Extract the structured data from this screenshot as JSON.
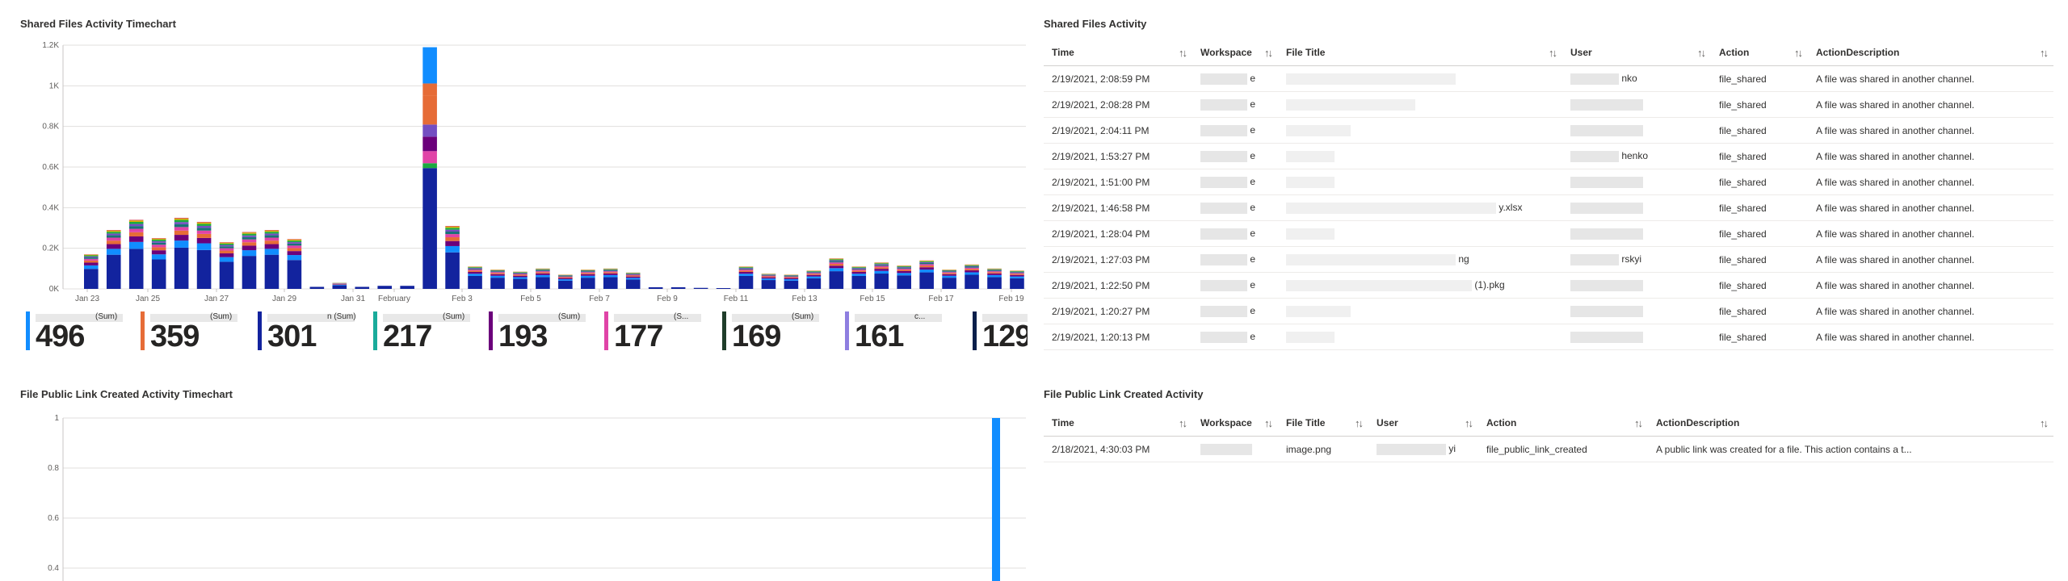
{
  "panels": {
    "shared_chart_title": "Shared Files Activity Timechart",
    "shared_table_title": "Shared Files Activity",
    "public_chart_title": "File Public Link Created Activity Timechart",
    "public_table_title": "File Public Link Created Activity"
  },
  "chart_data": [
    {
      "type": "bar",
      "stacked": true,
      "title": "Shared Files Activity Timechart",
      "y_ticks": [
        "0K",
        "0.2K",
        "0.4K",
        "0.6K",
        "0.8K",
        "1K",
        "1.2K"
      ],
      "ylim": [
        0,
        1200
      ],
      "x_ticks": [
        "Jan 23",
        "Jan 25",
        "Jan 27",
        "Jan 29",
        "Jan 31",
        "February",
        "Feb 3",
        "Feb 5",
        "Feb 7",
        "Feb 9",
        "Feb 11",
        "Feb 13",
        "Feb 15",
        "Feb 17",
        "Feb 19"
      ],
      "grid": true,
      "colors": [
        "#12239e",
        "#118dff",
        "#e66c37",
        "#6b007b",
        "#e044a7",
        "#744ec2",
        "#1aab40",
        "#d9b300",
        "#d64550",
        "#197278"
      ],
      "totals": [
        170,
        290,
        340,
        250,
        350,
        330,
        230,
        280,
        290,
        245,
        10,
        30,
        10,
        15,
        15,
        1190,
        310,
        110,
        95,
        85,
        100,
        70,
        95,
        100,
        80,
        8,
        8,
        5,
        4,
        110,
        75,
        70,
        90,
        150,
        110,
        130,
        115,
        140,
        95,
        120,
        100,
        90
      ]
    },
    {
      "type": "bar",
      "title": "File Public Link Created Activity Timechart",
      "y_ticks": [
        "0.4",
        "0.6",
        "0.8",
        "1"
      ],
      "ylim": [
        0.3,
        1
      ],
      "values_note_series": "single spike on last day",
      "spike_value": 1,
      "grid": true,
      "color": "#118dff"
    }
  ],
  "tiles": [
    {
      "value": "496",
      "label": "(Sum)",
      "color": "#118dff"
    },
    {
      "value": "359",
      "label": "(Sum)",
      "color": "#e66c37"
    },
    {
      "value": "301",
      "label": "n (Sum)",
      "color": "#12239e"
    },
    {
      "value": "217",
      "label": "(Sum)",
      "color": "#1aab9b"
    },
    {
      "value": "193",
      "label": "(Sum)",
      "color": "#6b007b"
    },
    {
      "value": "177",
      "label": "(S...",
      "color": "#e044a7"
    },
    {
      "value": "169",
      "label": "(Sum)",
      "color": "#1f3d2a"
    },
    {
      "value": "161",
      "label": "c...",
      "color": "#8e7ee0"
    },
    {
      "value": "129",
      "label": "",
      "color": "#0b1f4b"
    }
  ],
  "shared_table": {
    "columns": [
      "Time",
      "Workspace",
      "File Title",
      "User",
      "Action",
      "ActionDescription"
    ],
    "rows": [
      [
        "2/19/2021, 2:08:59 PM",
        "e",
        "",
        "nko",
        "file_shared",
        "A file was shared in another channel."
      ],
      [
        "2/19/2021, 2:08:28 PM",
        "e",
        "",
        "",
        "file_shared",
        "A file was shared in another channel."
      ],
      [
        "2/19/2021, 2:04:11 PM",
        "e",
        "",
        "",
        "file_shared",
        "A file was shared in another channel."
      ],
      [
        "2/19/2021, 1:53:27 PM",
        "e",
        "",
        "henko",
        "file_shared",
        "A file was shared in another channel."
      ],
      [
        "2/19/2021, 1:51:00 PM",
        "e",
        "",
        "",
        "file_shared",
        "A file was shared in another channel."
      ],
      [
        "2/19/2021, 1:46:58 PM",
        "e",
        "y.xlsx",
        "",
        "file_shared",
        "A file was shared in another channel."
      ],
      [
        "2/19/2021, 1:28:04 PM",
        "e",
        "",
        "",
        "file_shared",
        "A file was shared in another channel."
      ],
      [
        "2/19/2021, 1:27:03 PM",
        "e",
        "ng",
        "rskyi",
        "file_shared",
        "A file was shared in another channel."
      ],
      [
        "2/19/2021, 1:22:50 PM",
        "e",
        "(1).pkg",
        "",
        "file_shared",
        "A file was shared in another channel."
      ],
      [
        "2/19/2021, 1:20:27 PM",
        "e",
        "",
        "",
        "file_shared",
        "A file was shared in another channel."
      ],
      [
        "2/19/2021, 1:20:13 PM",
        "e",
        "",
        "",
        "file_shared",
        "A file was shared in another channel."
      ]
    ]
  },
  "public_table": {
    "columns": [
      "Time",
      "Workspace",
      "File Title",
      "User",
      "Action",
      "ActionDescription"
    ],
    "rows": [
      [
        "2/18/2021, 4:30:03 PM",
        "",
        "image.png",
        "yi",
        "file_public_link_created",
        "A public link was created for a file. This action contains a t..."
      ]
    ]
  },
  "icons": {
    "sort": "sort-arrows-icon"
  }
}
